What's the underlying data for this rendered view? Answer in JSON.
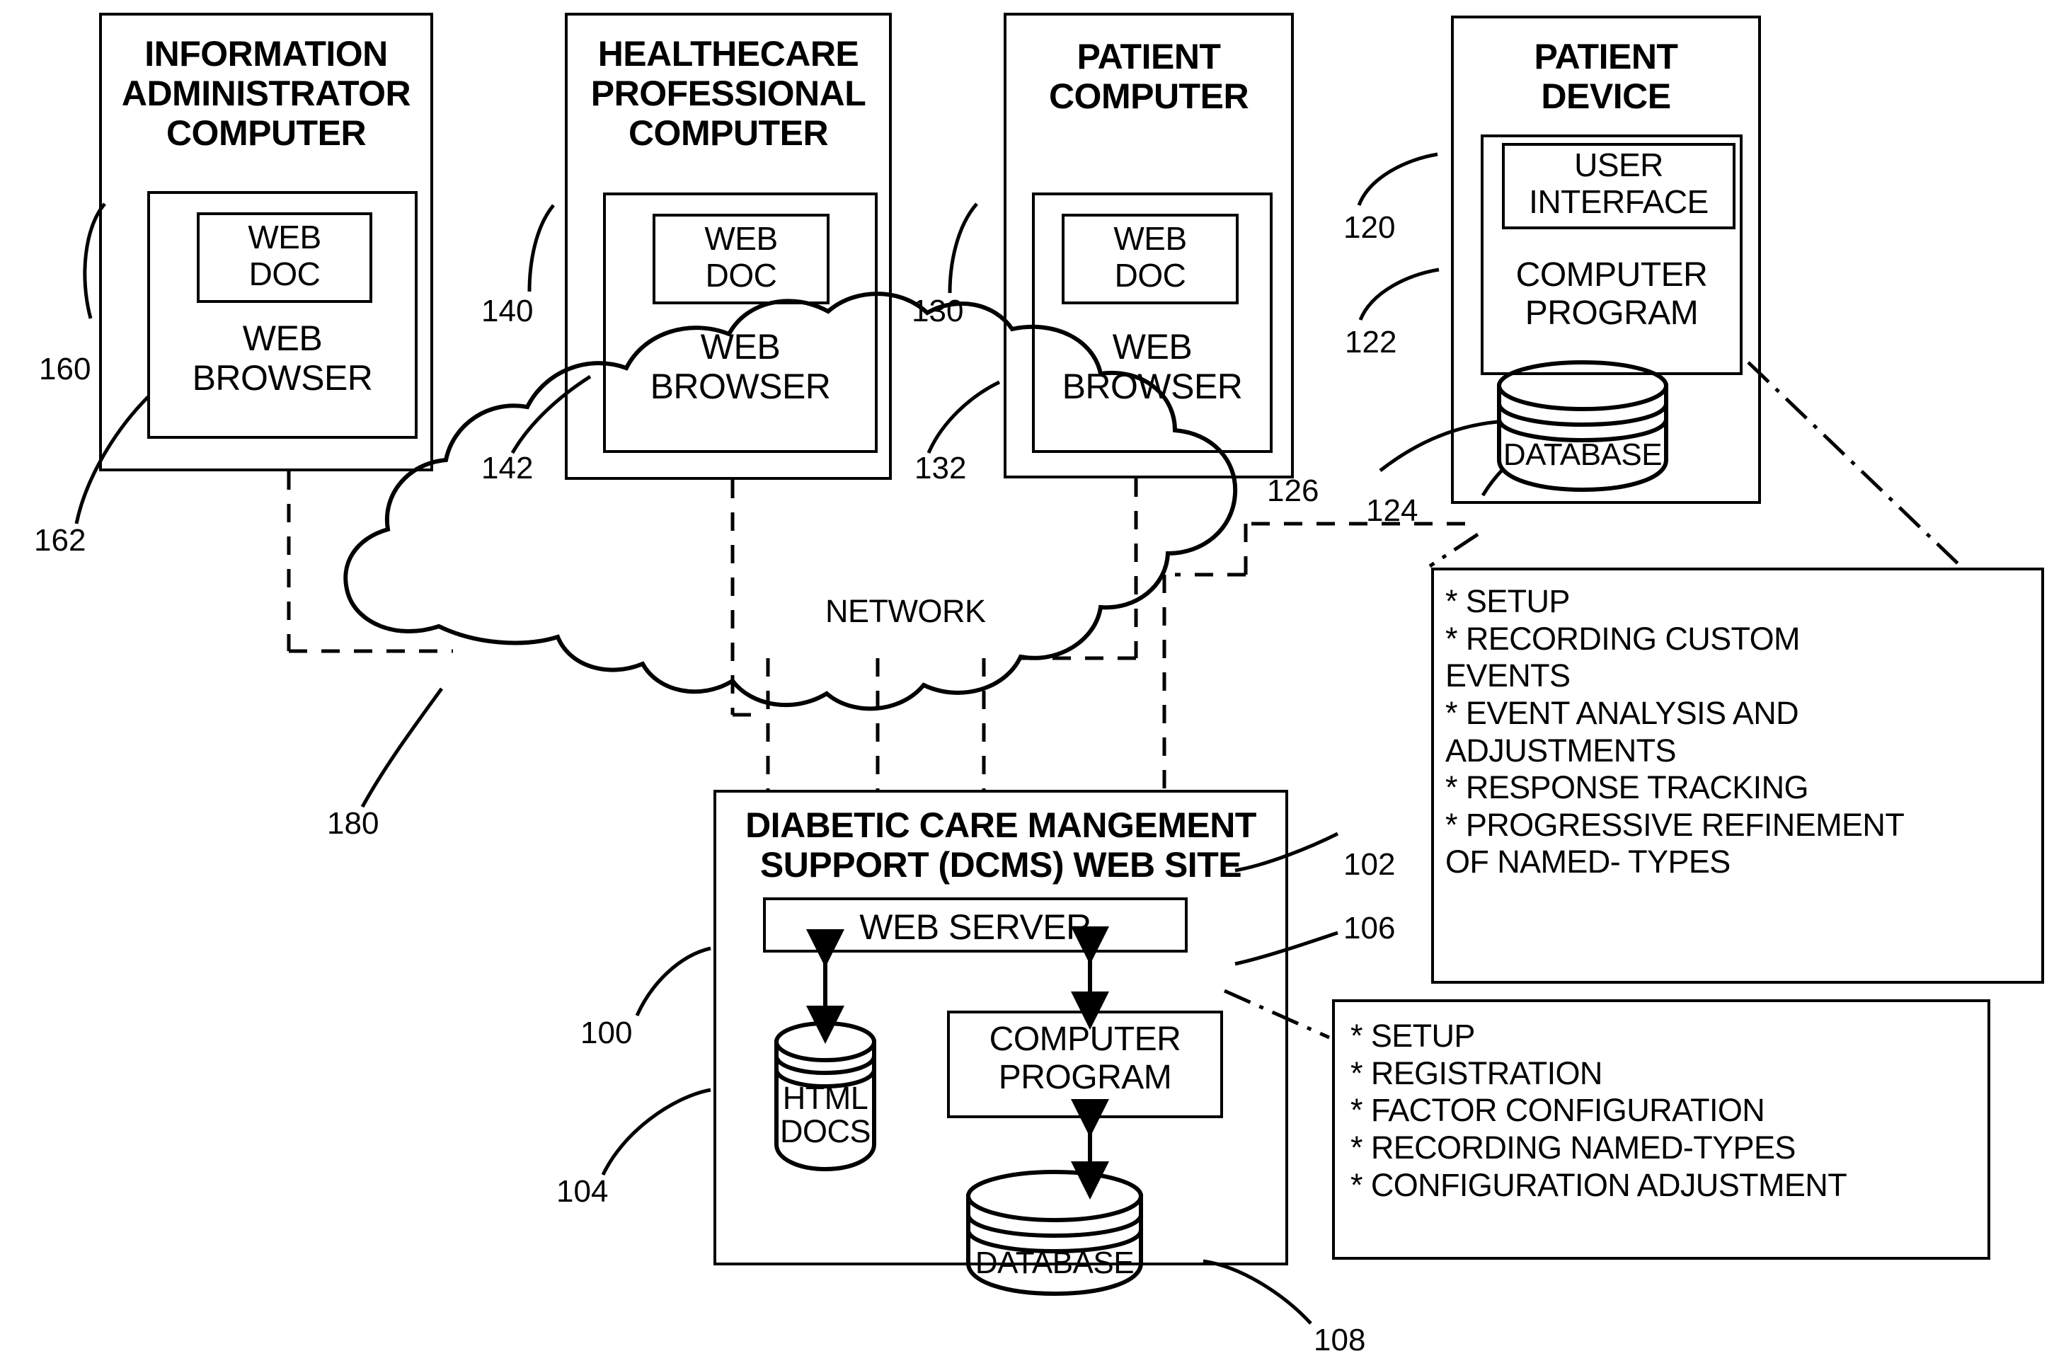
{
  "figure": {
    "type": "patent-system-architecture-diagram"
  },
  "nodes": {
    "information_administrator_computer": {
      "title": "INFORMATION\nADMINISTRATOR\nCOMPUTER",
      "title_lines": [
        "INFORMATION",
        "ADMINISTRATOR",
        "COMPUTER"
      ],
      "inner_browser": "WEB\nBROWSER",
      "inner_browser_lines": [
        "WEB",
        "BROWSER"
      ],
      "inner_doc": "WEB\nDOC",
      "inner_doc_lines": [
        "WEB",
        "DOC"
      ],
      "ref_outer": "160",
      "ref_inner": "162"
    },
    "healthcare_professional_computer": {
      "title_lines": [
        "HEALTHECARE",
        "PROFESSIONAL",
        "COMPUTER"
      ],
      "inner_browser_lines": [
        "WEB",
        "BROWSER"
      ],
      "inner_doc_lines": [
        "WEB",
        "DOC"
      ],
      "ref_outer": "140",
      "ref_inner": "142"
    },
    "patient_computer": {
      "title_lines": [
        "PATIENT",
        "COMPUTER"
      ],
      "inner_browser_lines": [
        "WEB",
        "BROWSER"
      ],
      "inner_doc_lines": [
        "WEB",
        "DOC"
      ],
      "ref_outer": "130",
      "ref_inner": "132"
    },
    "patient_device": {
      "title_lines": [
        "PATIENT",
        "DEVICE"
      ],
      "user_interface_lines": [
        "USER",
        "INTERFACE"
      ],
      "computer_program_lines": [
        "COMPUTER",
        "PROGRAM"
      ],
      "database_label": "DATABASE",
      "ref_device": "126",
      "ref_ui": "120",
      "ref_program": "122",
      "ref_database": "124"
    },
    "network": {
      "label": "NETWORK",
      "ref": "180"
    },
    "dcms_website": {
      "title_lines": [
        "DIABETIC CARE MANGEMENT",
        "SUPPORT (DCMS) WEB SITE"
      ],
      "web_server": "WEB SERVER",
      "html_docs_lines": [
        "HTML",
        "DOCS"
      ],
      "computer_program_lines": [
        "COMPUTER",
        "PROGRAM"
      ],
      "database_label": "DATABASE",
      "ref_site": "100",
      "ref_web_server": "102",
      "ref_html_docs": "104",
      "ref_computer_program": "106",
      "ref_database": "108"
    }
  },
  "callouts": {
    "patient_device_functions": {
      "items": [
        "* SETUP",
        "* RECORDING CUSTOM\nEVENTS",
        "* EVENT ANALYSIS AND\nADJUSTMENTS",
        "* RESPONSE TRACKING",
        "* PROGRESSIVE REFINEMENT\nOF NAMED- TYPES"
      ]
    },
    "dcms_program_functions": {
      "items": [
        "* SETUP",
        "* REGISTRATION",
        "* FACTOR CONFIGURATION",
        "* RECORDING NAMED-TYPES",
        "* CONFIGURATION ADJUSTMENT"
      ]
    }
  },
  "colors": {
    "ink": "#000000",
    "paper": "#ffffff"
  }
}
